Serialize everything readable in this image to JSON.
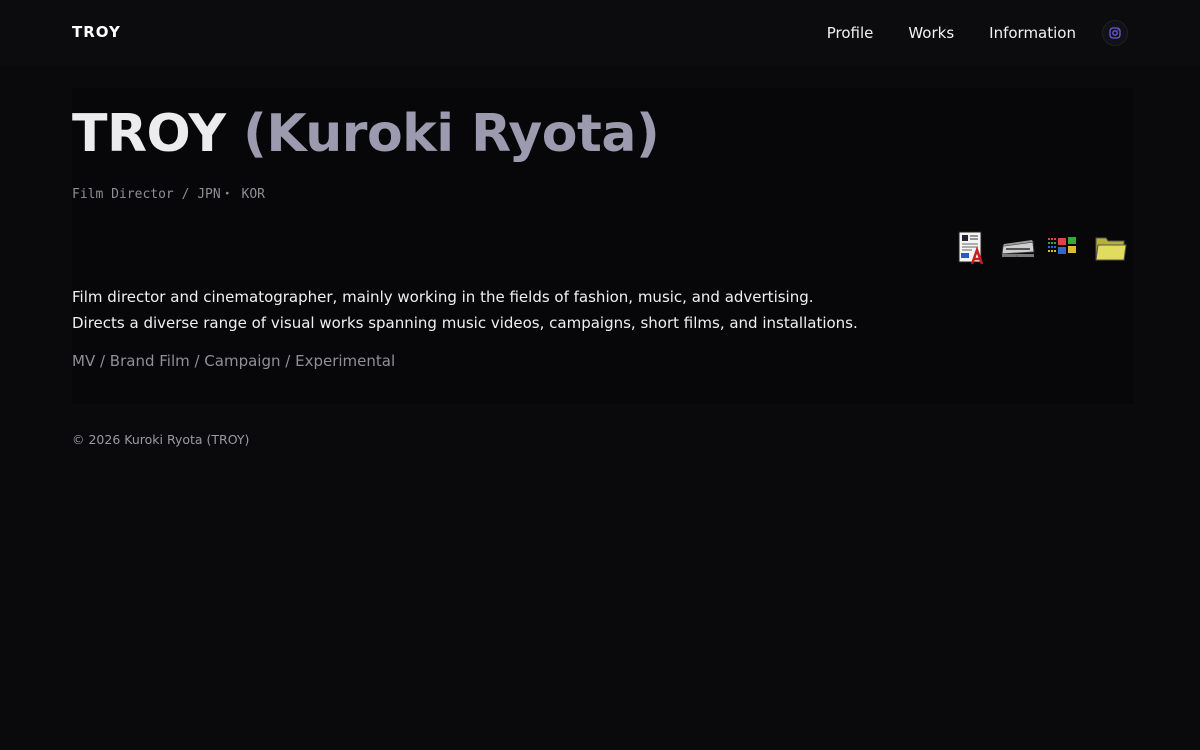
{
  "header": {
    "logo": "TROY",
    "nav": [
      "Profile",
      "Works",
      "Information"
    ],
    "social_icon": "instagram-icon"
  },
  "hero": {
    "name": "TROY",
    "name_sub": "(Kuroki Ryota)",
    "role": "Film Director / JPN・ KOR"
  },
  "desktop_icons": [
    "document-icon",
    "scanner-icon",
    "windows-icon",
    "folder-icon"
  ],
  "bio": {
    "line1": "Film director and cinematographer, mainly working in the fields of fashion, music, and advertising.",
    "line2": "Directs a diverse range of visual works spanning music videos, campaigns, short films, and installations.",
    "tags": "MV / Brand Film / Campaign / Experimental"
  },
  "footer": {
    "copyright": "© 2026 Kuroki Ryota (TROY)"
  },
  "colors": {
    "background": "#0a0a0c",
    "name_accent": "#9c9aae",
    "muted": "#8f8f96"
  }
}
